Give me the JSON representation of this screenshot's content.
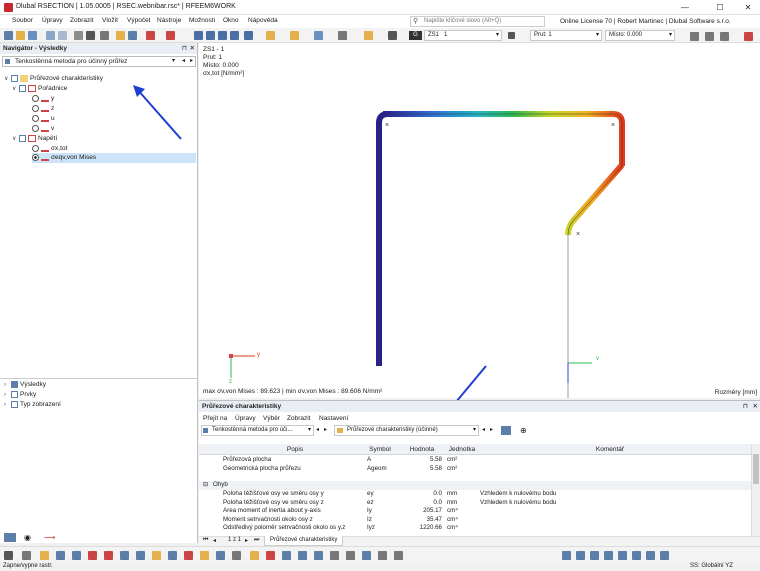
{
  "window": {
    "title": "Dlubal RSECTION | 1.05.0005 | RSEC.webnibar.rsc* | RFEEM6WORK",
    "license": "Online License 70 | Robert Martinec | Dlubal Software s.r.o.",
    "search_placeholder": "Napište klíčové slovo (Alt+Q)"
  },
  "menu": [
    "Soubor",
    "Úpravy",
    "Zobrazit",
    "Vložit",
    "Výpočet",
    "Nástroje",
    "Možnosti",
    "Okno",
    "Nápověda"
  ],
  "toolbar": {
    "lc_badge": "G",
    "lc_name": "ZS1",
    "lc_num": "1",
    "member": "Prut: 1",
    "location": "Místo: 0.000"
  },
  "navigator": {
    "title": "Navigátor - Výsledky",
    "selector": "Tenkostěnná metoda pro účinný průřez",
    "tree": [
      {
        "label": "Průřezové charakteristiky",
        "level": 0
      },
      {
        "label": "Pořadnice",
        "level": 1
      },
      {
        "label": "y",
        "level": 2
      },
      {
        "label": "z",
        "level": 2
      },
      {
        "label": "u",
        "level": 2
      },
      {
        "label": "v",
        "level": 2
      },
      {
        "label": "Napětí",
        "level": 1
      },
      {
        "label": "σx,tot",
        "level": 2
      },
      {
        "label": "σeqv,von Mises",
        "level": 2
      }
    ],
    "bottom_items": [
      "Výsledky",
      "Prvky",
      "Typ zobrazení"
    ]
  },
  "viewport": {
    "info": [
      "ZS1 - 1",
      "Prut: 1",
      "Místo: 0.000",
      "σx,tot [N/mm²]"
    ],
    "summary": "max σv,von Mises : 89.623 | min σv,von Mises : 89.606 N/mm²",
    "dims": "Rozměry [mm]",
    "axis_y": "y",
    "axis_z": "z",
    "axis_v": "v"
  },
  "results": {
    "title": "Průřezové charakteristiky",
    "menu": [
      "Přejít na",
      "Úpravy",
      "Výběr",
      "Zobrazit",
      "Nastavení"
    ],
    "method": "Tenkostěnná metoda pro úči...",
    "table_sel": "Průřezové charakteristiky (účinné)",
    "headers": [
      "Popis",
      "Symbol",
      "Hodnota",
      "Jednotka",
      "Komentář"
    ],
    "rows": [
      {
        "p": "Průřezová plocha",
        "s": "A",
        "v": "5.58",
        "u": "cm²",
        "c": ""
      },
      {
        "p": "Geometrická plocha průřezu",
        "s": "Ageom",
        "v": "5.58",
        "u": "cm²",
        "c": ""
      }
    ],
    "group": "Ohyb",
    "rows2": [
      {
        "p": "Poloha těžišťové osy ve směru osy y",
        "s": "ey",
        "v": "0.0",
        "u": "mm",
        "c": "Vzhledem k nulovému bodu"
      },
      {
        "p": "Poloha těžišťové osy ve směru osy z",
        "s": "ez",
        "v": "0.0",
        "u": "mm",
        "c": "Vzhledem k nulovému bodu"
      },
      {
        "p": "Area moment of inertia about y-axis",
        "s": "Iy",
        "v": "205.17",
        "u": "cm⁴",
        "c": ""
      },
      {
        "p": "Moment setrvačnosti okolo osy z",
        "s": "Iz",
        "v": "35.47",
        "u": "cm⁴",
        "c": ""
      },
      {
        "p": "Odstředivý poloměr setrvačnosti okolo os y,z",
        "s": "Iyz",
        "v": "1220.66",
        "u": "cm⁴",
        "c": ""
      }
    ],
    "pager": "1 z 1",
    "tab": "Průřezové charakteristiky"
  },
  "status": {
    "left": "Zapne/vypne rastr.",
    "right": "SS: Globální YZ"
  }
}
